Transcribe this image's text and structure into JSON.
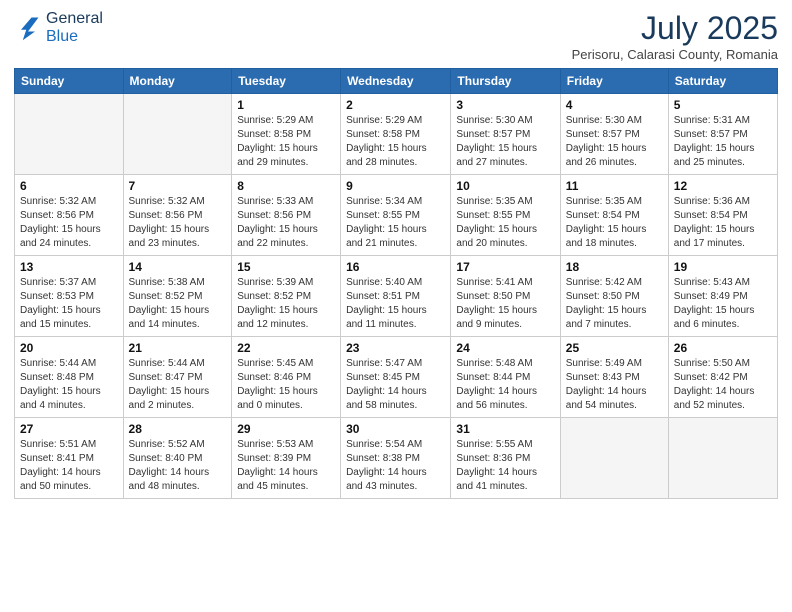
{
  "logo": {
    "line1": "General",
    "line2": "Blue"
  },
  "header": {
    "month": "July 2025",
    "location": "Perisoru, Calarasi County, Romania"
  },
  "weekdays": [
    "Sunday",
    "Monday",
    "Tuesday",
    "Wednesday",
    "Thursday",
    "Friday",
    "Saturday"
  ],
  "weeks": [
    [
      null,
      null,
      {
        "day": "1",
        "sunrise": "5:29 AM",
        "sunset": "8:58 PM",
        "daylight": "15 hours and 29 minutes."
      },
      {
        "day": "2",
        "sunrise": "5:29 AM",
        "sunset": "8:58 PM",
        "daylight": "15 hours and 28 minutes."
      },
      {
        "day": "3",
        "sunrise": "5:30 AM",
        "sunset": "8:57 PM",
        "daylight": "15 hours and 27 minutes."
      },
      {
        "day": "4",
        "sunrise": "5:30 AM",
        "sunset": "8:57 PM",
        "daylight": "15 hours and 26 minutes."
      },
      {
        "day": "5",
        "sunrise": "5:31 AM",
        "sunset": "8:57 PM",
        "daylight": "15 hours and 25 minutes."
      }
    ],
    [
      {
        "day": "6",
        "sunrise": "5:32 AM",
        "sunset": "8:56 PM",
        "daylight": "15 hours and 24 minutes."
      },
      {
        "day": "7",
        "sunrise": "5:32 AM",
        "sunset": "8:56 PM",
        "daylight": "15 hours and 23 minutes."
      },
      {
        "day": "8",
        "sunrise": "5:33 AM",
        "sunset": "8:56 PM",
        "daylight": "15 hours and 22 minutes."
      },
      {
        "day": "9",
        "sunrise": "5:34 AM",
        "sunset": "8:55 PM",
        "daylight": "15 hours and 21 minutes."
      },
      {
        "day": "10",
        "sunrise": "5:35 AM",
        "sunset": "8:55 PM",
        "daylight": "15 hours and 20 minutes."
      },
      {
        "day": "11",
        "sunrise": "5:35 AM",
        "sunset": "8:54 PM",
        "daylight": "15 hours and 18 minutes."
      },
      {
        "day": "12",
        "sunrise": "5:36 AM",
        "sunset": "8:54 PM",
        "daylight": "15 hours and 17 minutes."
      }
    ],
    [
      {
        "day": "13",
        "sunrise": "5:37 AM",
        "sunset": "8:53 PM",
        "daylight": "15 hours and 15 minutes."
      },
      {
        "day": "14",
        "sunrise": "5:38 AM",
        "sunset": "8:52 PM",
        "daylight": "15 hours and 14 minutes."
      },
      {
        "day": "15",
        "sunrise": "5:39 AM",
        "sunset": "8:52 PM",
        "daylight": "15 hours and 12 minutes."
      },
      {
        "day": "16",
        "sunrise": "5:40 AM",
        "sunset": "8:51 PM",
        "daylight": "15 hours and 11 minutes."
      },
      {
        "day": "17",
        "sunrise": "5:41 AM",
        "sunset": "8:50 PM",
        "daylight": "15 hours and 9 minutes."
      },
      {
        "day": "18",
        "sunrise": "5:42 AM",
        "sunset": "8:50 PM",
        "daylight": "15 hours and 7 minutes."
      },
      {
        "day": "19",
        "sunrise": "5:43 AM",
        "sunset": "8:49 PM",
        "daylight": "15 hours and 6 minutes."
      }
    ],
    [
      {
        "day": "20",
        "sunrise": "5:44 AM",
        "sunset": "8:48 PM",
        "daylight": "15 hours and 4 minutes."
      },
      {
        "day": "21",
        "sunrise": "5:44 AM",
        "sunset": "8:47 PM",
        "daylight": "15 hours and 2 minutes."
      },
      {
        "day": "22",
        "sunrise": "5:45 AM",
        "sunset": "8:46 PM",
        "daylight": "15 hours and 0 minutes."
      },
      {
        "day": "23",
        "sunrise": "5:47 AM",
        "sunset": "8:45 PM",
        "daylight": "14 hours and 58 minutes."
      },
      {
        "day": "24",
        "sunrise": "5:48 AM",
        "sunset": "8:44 PM",
        "daylight": "14 hours and 56 minutes."
      },
      {
        "day": "25",
        "sunrise": "5:49 AM",
        "sunset": "8:43 PM",
        "daylight": "14 hours and 54 minutes."
      },
      {
        "day": "26",
        "sunrise": "5:50 AM",
        "sunset": "8:42 PM",
        "daylight": "14 hours and 52 minutes."
      }
    ],
    [
      {
        "day": "27",
        "sunrise": "5:51 AM",
        "sunset": "8:41 PM",
        "daylight": "14 hours and 50 minutes."
      },
      {
        "day": "28",
        "sunrise": "5:52 AM",
        "sunset": "8:40 PM",
        "daylight": "14 hours and 48 minutes."
      },
      {
        "day": "29",
        "sunrise": "5:53 AM",
        "sunset": "8:39 PM",
        "daylight": "14 hours and 45 minutes."
      },
      {
        "day": "30",
        "sunrise": "5:54 AM",
        "sunset": "8:38 PM",
        "daylight": "14 hours and 43 minutes."
      },
      {
        "day": "31",
        "sunrise": "5:55 AM",
        "sunset": "8:36 PM",
        "daylight": "14 hours and 41 minutes."
      },
      null,
      null
    ]
  ]
}
